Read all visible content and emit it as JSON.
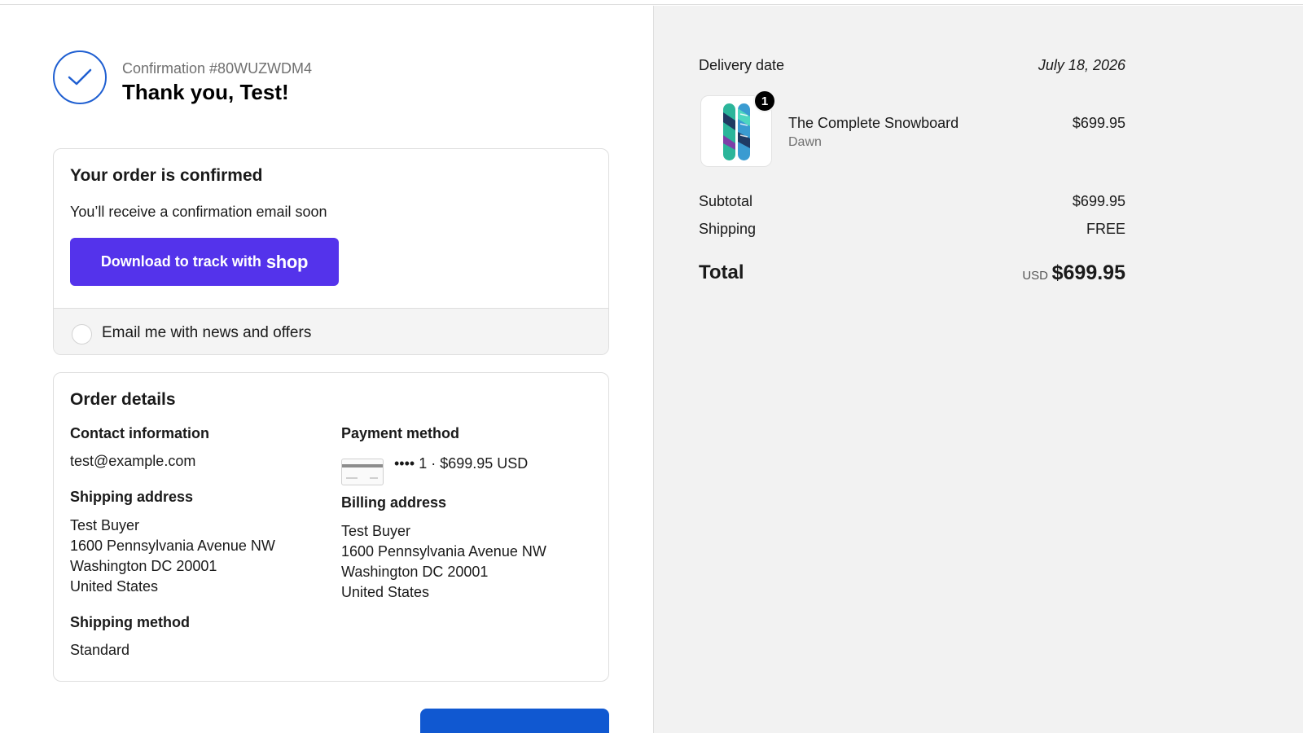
{
  "header": {
    "confirmation": "Confirmation #80WUZWDM4",
    "thanks": "Thank you, Test!"
  },
  "order_status": {
    "title": "Your order is confirmed",
    "subtitle": "You’ll receive a confirmation email soon",
    "shop_button_label": "Download to track with",
    "shop_button_brand": "shop",
    "email_opt_in_label": "Email me with news and offers",
    "email_opt_in_checked": false
  },
  "order_details": {
    "title": "Order details",
    "contact": {
      "label": "Contact information",
      "email": "test@example.com"
    },
    "payment": {
      "label": "Payment method",
      "summary": "•••• 1 · $699.95 USD"
    },
    "shipping_address": {
      "label": "Shipping address",
      "lines": [
        "Test Buyer",
        "1600 Pennsylvania Avenue NW",
        "Washington DC 20001",
        "United States"
      ]
    },
    "billing_address": {
      "label": "Billing address",
      "lines": [
        "Test Buyer",
        "1600 Pennsylvania Avenue NW",
        "Washington DC 20001",
        "United States"
      ]
    },
    "shipping_method": {
      "label": "Shipping method",
      "value": "Standard"
    }
  },
  "summary": {
    "delivery_label": "Delivery date",
    "delivery_date": "July 18, 2026",
    "item": {
      "quantity": "1",
      "name": "The Complete Snowboard",
      "variant": "Dawn",
      "price": "$699.95"
    },
    "subtotal_label": "Subtotal",
    "subtotal_value": "$699.95",
    "shipping_label": "Shipping",
    "shipping_value": "FREE",
    "total_label": "Total",
    "total_currency": "USD",
    "total_value": "$699.95"
  },
  "icons": [
    "checkmark-icon",
    "credit-card-icon",
    "snowboard-product-image"
  ],
  "colors": {
    "accent": "#1f5fd1",
    "shop_purple": "#5433eb",
    "primary_button": "#1058d1",
    "aside_bg": "#f2f2f2"
  }
}
